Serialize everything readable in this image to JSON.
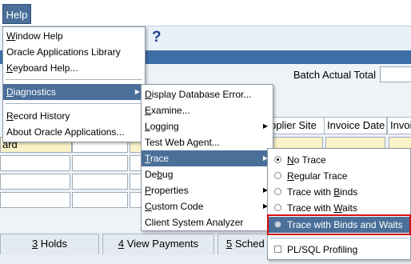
{
  "menubar": {
    "help_label": "Help"
  },
  "toolbar": {
    "help_icon_glyph": "?"
  },
  "form": {
    "batch_actual_total_label": "Batch Actual Total",
    "columns": [
      "pplier Site",
      "Invoice Date",
      "Invoi"
    ],
    "row1_value": "ard"
  },
  "tabs": [
    {
      "key": "3",
      "rest": " Holds"
    },
    {
      "key": "4",
      "rest": " View Payments"
    },
    {
      "key": "5",
      "rest": " Sched"
    }
  ],
  "help_menu": [
    {
      "key": "W",
      "rest": "indow Help"
    },
    {
      "key": "",
      "rest": "Oracle Applications Library"
    },
    {
      "key": "K",
      "rest": "eyboard Help..."
    },
    {
      "key": "D",
      "rest": "iagnostics"
    },
    {
      "key": "R",
      "rest": "ecord History"
    },
    {
      "key": "",
      "rest": "About Oracle Applications..."
    }
  ],
  "diagnostics_menu": [
    {
      "key": "D",
      "rest": "isplay Database Error..."
    },
    {
      "key": "E",
      "rest": "xamine..."
    },
    {
      "key": "L",
      "rest": "ogging"
    },
    {
      "key": "",
      "rest": "Test Web Agent..."
    },
    {
      "key": "T",
      "rest": "race"
    },
    {
      "key": "",
      "rest": "Debug",
      "pre": "De",
      "key2": "b",
      "post": "ug"
    },
    {
      "key": "P",
      "rest": "roperties"
    },
    {
      "key": "C",
      "rest": "ustom Code"
    },
    {
      "key": "",
      "rest": "Client System Analyzer"
    }
  ],
  "trace_menu": [
    {
      "key": "N",
      "rest": "o Trace",
      "selected": true
    },
    {
      "key": "R",
      "rest": "egular Trace",
      "selected": false
    },
    {
      "key": "",
      "pre": "Trace with ",
      "key2": "B",
      "post": "inds",
      "selected": false
    },
    {
      "key": "",
      "pre": "Trace with ",
      "key2": "W",
      "post": "aits",
      "selected": false
    },
    {
      "key": "",
      "pre": "Trace with Binds and Waits",
      "selected": false
    },
    {
      "key": "",
      "pre": "PL/SQL Profiling",
      "checked": false
    }
  ],
  "colors": {
    "menu_highlight": "#4a6f99",
    "annotation_box": "#d60f0f",
    "title_bar": "#3e6ea6"
  }
}
